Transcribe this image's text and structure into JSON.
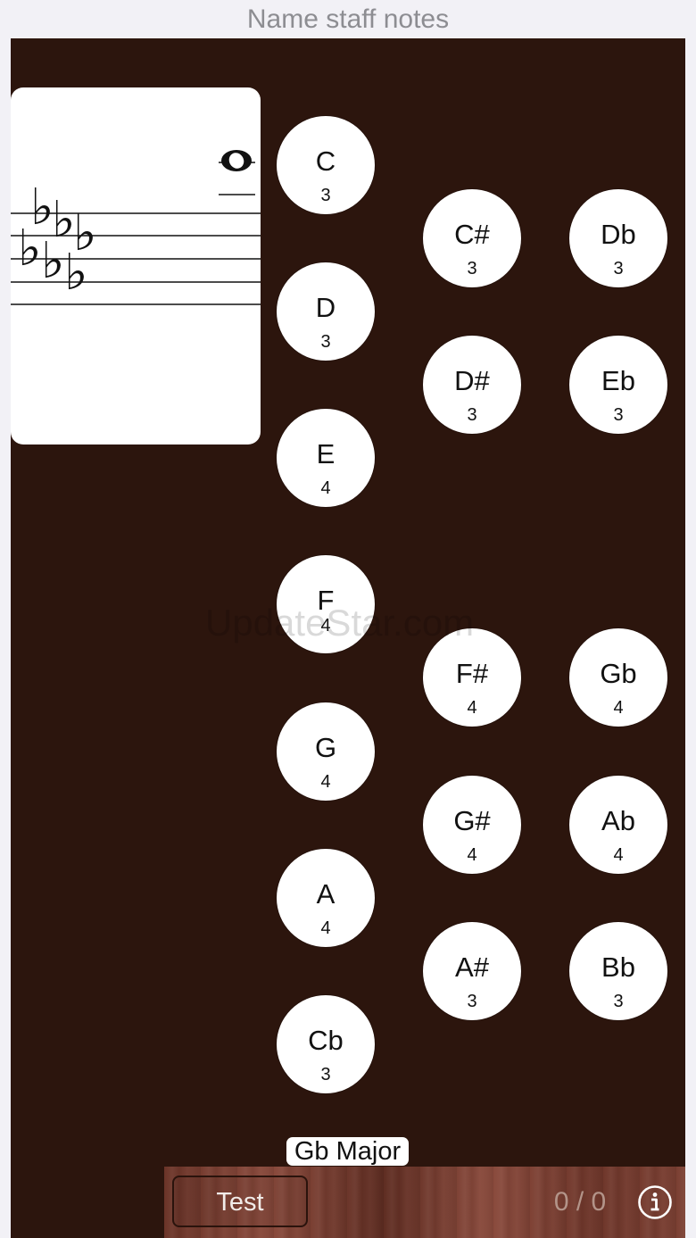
{
  "header": {
    "title": "Name staff notes"
  },
  "staff": {
    "key_signature": "six flats (Gb major)",
    "displayed_note": "whole note on ledger lines above treble staff"
  },
  "natural_notes": [
    {
      "name": "C",
      "octave": "3"
    },
    {
      "name": "D",
      "octave": "3"
    },
    {
      "name": "E",
      "octave": "4"
    },
    {
      "name": "F",
      "octave": "4"
    },
    {
      "name": "G",
      "octave": "4"
    },
    {
      "name": "A",
      "octave": "4"
    },
    {
      "name": "Cb",
      "octave": "3"
    }
  ],
  "sharp_notes": [
    {
      "name": "C#",
      "octave": "3"
    },
    {
      "name": "D#",
      "octave": "3"
    },
    {
      "name": "F#",
      "octave": "4"
    },
    {
      "name": "G#",
      "octave": "4"
    },
    {
      "name": "A#",
      "octave": "3"
    }
  ],
  "flat_notes": [
    {
      "name": "Db",
      "octave": "3"
    },
    {
      "name": "Eb",
      "octave": "3"
    },
    {
      "name": "Gb",
      "octave": "4"
    },
    {
      "name": "Ab",
      "octave": "4"
    },
    {
      "name": "Bb",
      "octave": "3"
    }
  ],
  "key_label": "Gb Major",
  "footer": {
    "test_label": "Test",
    "score": "0 / 0",
    "info_icon": "info-circle-icon"
  },
  "watermark": "UpdateStar.com",
  "colors": {
    "board": "#2c150d",
    "button": "#ffffff",
    "title": "#8d8d92",
    "score": "#b39489"
  }
}
